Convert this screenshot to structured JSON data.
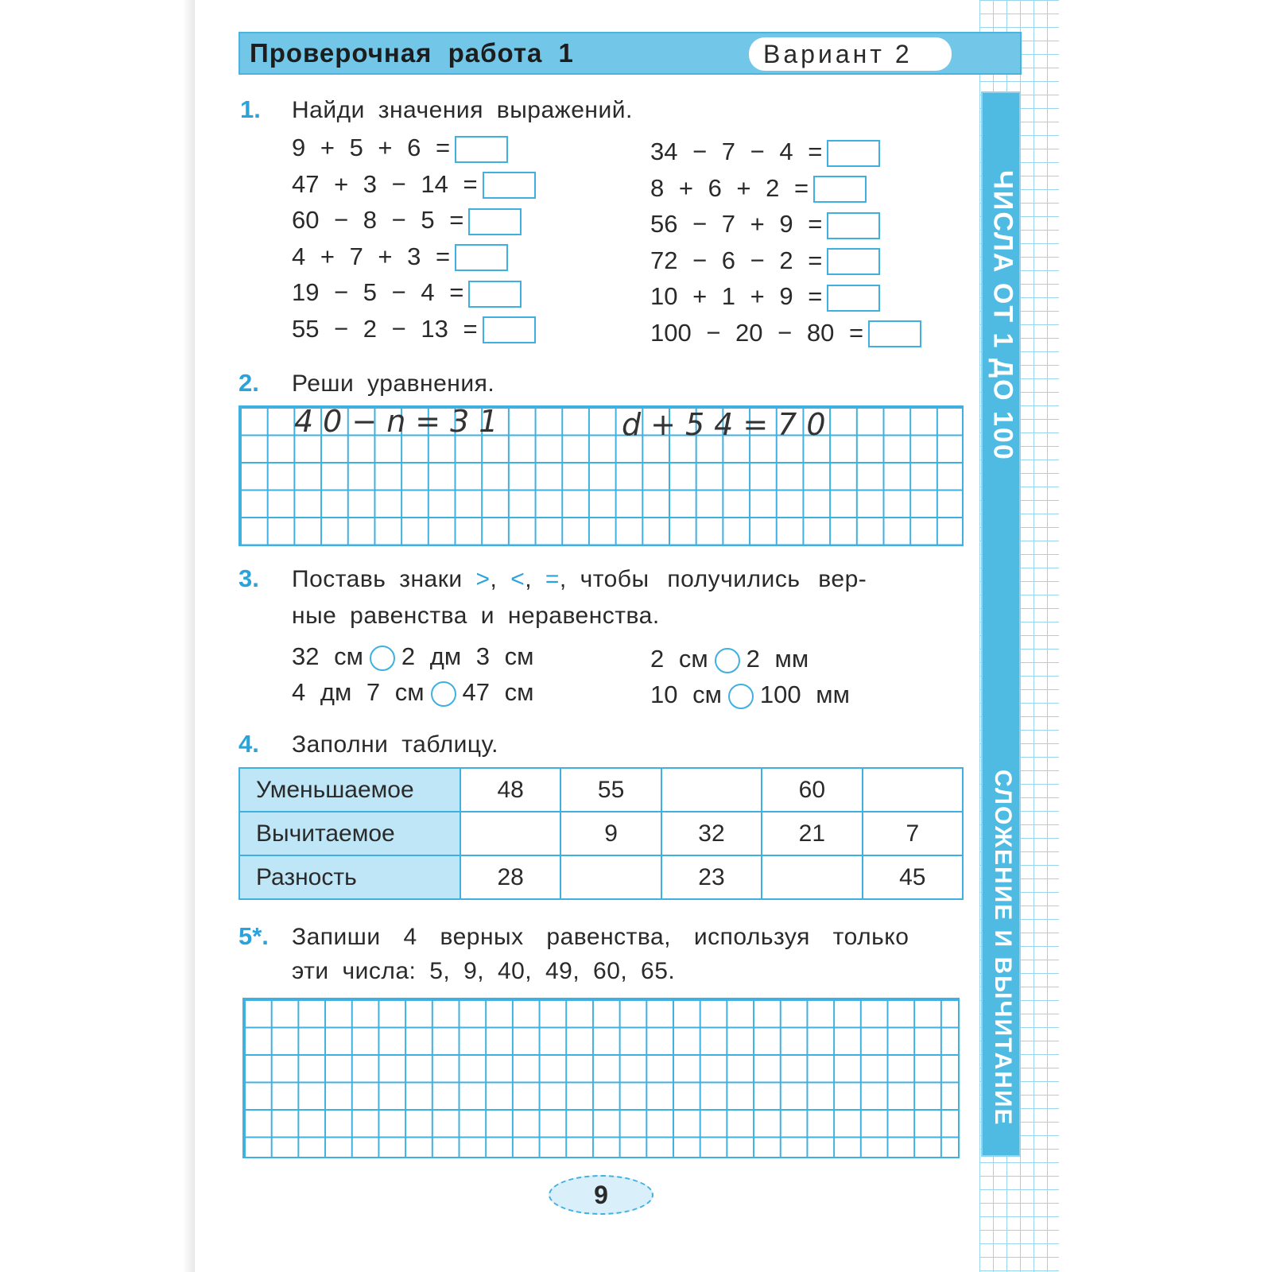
{
  "header": {
    "title": "Проверочная работа 1",
    "variant": "Вариант 2"
  },
  "side": {
    "top": "ЧИСЛА ОТ 1 ДО 100",
    "bottom": "СЛОЖЕНИЕ И ВЫЧИТАНИЕ"
  },
  "task1": {
    "num": "1.",
    "text": "Найди значения выражений.",
    "left": [
      "9 + 5 + 6 =",
      "47 + 3 − 14 =",
      "60 − 8 − 5 =",
      "4 + 7 + 3 =",
      "19 − 5 − 4 =",
      "55 − 2 − 13 ="
    ],
    "right": [
      "34 − 7 − 4 =",
      "8 + 6 + 2 =",
      "56 − 7 + 9 =",
      "72 − 6 − 2 =",
      "10 + 1 + 9 =",
      "100 − 20 − 80 ="
    ]
  },
  "task2": {
    "num": "2.",
    "text": "Реши уравнения.",
    "eq1": "40−n=31",
    "eq2": "d+54=70"
  },
  "task3": {
    "num": "3.",
    "text_a": "Поставь знаки",
    "signs": [
      ">",
      "<",
      "="
    ],
    "text_b": "чтобы получились вер-",
    "text_c": "ные равенства и неравенства.",
    "pairs": [
      [
        "32 см",
        "2 дм 3 см"
      ],
      [
        "4 дм 7 см",
        "47 см"
      ],
      [
        "2 см",
        "2 мм"
      ],
      [
        "10 см",
        "100 мм"
      ]
    ]
  },
  "task4": {
    "num": "4.",
    "text": "Заполни таблицу.",
    "rows": [
      {
        "label": "Уменьшаемое",
        "cells": [
          "48",
          "55",
          "",
          "60",
          ""
        ]
      },
      {
        "label": "Вычитаемое",
        "cells": [
          "",
          "9",
          "32",
          "21",
          "7"
        ]
      },
      {
        "label": "Разность",
        "cells": [
          "28",
          "",
          "23",
          "",
          "45"
        ]
      }
    ]
  },
  "task5": {
    "num": "5*.",
    "line1": "Запиши 4 верных равенства, используя только",
    "line2": "эти числа: 5, 9, 40, 49, 60, 65."
  },
  "page_number": "9",
  "colors": {
    "accent": "#3fb0e0",
    "header": "#72c6e8",
    "strip": "#4fbbe3"
  }
}
